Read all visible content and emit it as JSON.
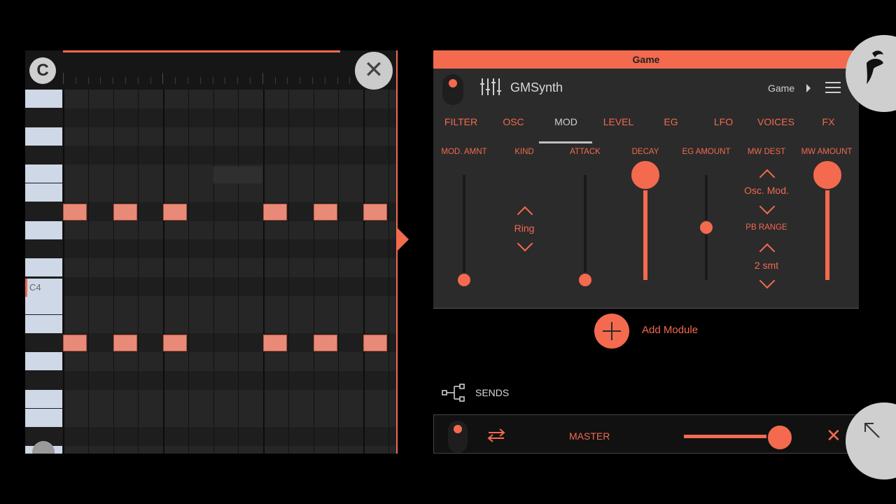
{
  "colors": {
    "accent": "#f36a4f",
    "panel": "#2b2b2b",
    "background": "#000000"
  },
  "piano_roll": {
    "logo_icon": "clip-logo-icon",
    "close_icon": "close-icon",
    "key_label": "C4"
  },
  "header": {
    "title": "Game"
  },
  "synth": {
    "name": "GMSynth",
    "preset": "Game",
    "mixer_icon": "mixer-icon",
    "menu_icon": "menu-icon",
    "tabs": [
      {
        "label": "FILTER"
      },
      {
        "label": "OSC"
      },
      {
        "label": "MOD"
      },
      {
        "label": "LEVEL"
      },
      {
        "label": "EG"
      },
      {
        "label": "LFO"
      },
      {
        "label": "VOICES"
      },
      {
        "label": "FX"
      }
    ],
    "active_tab": "MOD",
    "params": {
      "mod_amnt": {
        "label": "MOD. AMNT",
        "level": 0.0
      },
      "kind": {
        "label": "KIND",
        "value": "Ring"
      },
      "attack": {
        "label": "ATTACK",
        "level": 0.0
      },
      "decay": {
        "label": "DECAY",
        "level": 1.0
      },
      "eg_amount": {
        "label": "EG AMOUNT",
        "level": 0.5
      },
      "mw_dest": {
        "label": "MW DEST",
        "value": "Osc. Mod."
      },
      "pb_range": {
        "label": "PB RANGE",
        "value": "2 smt"
      },
      "mw_amount": {
        "label": "MW AMOUNT",
        "level": 1.0
      }
    }
  },
  "add_module": {
    "label": "Add Module"
  },
  "sends": {
    "label": "SENDS"
  },
  "master": {
    "label": "MASTER",
    "volume": 1.0
  }
}
